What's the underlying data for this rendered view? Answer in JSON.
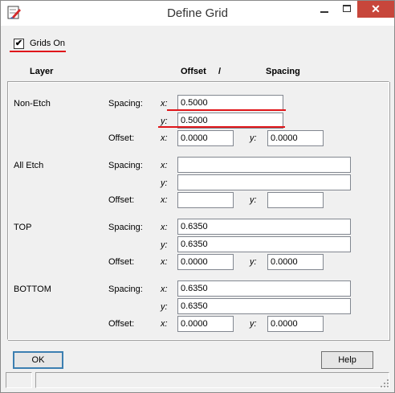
{
  "window": {
    "title": "Define Grid"
  },
  "grids_on": {
    "label": "Grids On",
    "checked": true,
    "check_glyph": "✔"
  },
  "headers": {
    "layer": "Layer",
    "offset": "Offset",
    "slash": "/",
    "spacing": "Spacing"
  },
  "layers": [
    {
      "name": "Non-Etch",
      "spacing_label": "Spacing:",
      "x_label": "x:",
      "spacing_x": "0.5000",
      "y_label": "y:",
      "spacing_y": "0.5000",
      "offset_label": "Offset:",
      "offset_x": "0.0000",
      "offset_y": "0.0000"
    },
    {
      "name": "All Etch",
      "spacing_label": "Spacing:",
      "x_label": "x:",
      "spacing_x": "",
      "y_label": "y:",
      "spacing_y": "",
      "offset_label": "Offset:",
      "offset_x": "",
      "offset_y": ""
    },
    {
      "name": "TOP",
      "spacing_label": "Spacing:",
      "x_label": "x:",
      "spacing_x": "0.6350",
      "y_label": "y:",
      "spacing_y": "0.6350",
      "offset_label": "Offset:",
      "offset_x": "0.0000",
      "offset_y": "0.0000"
    },
    {
      "name": "BOTTOM",
      "spacing_label": "Spacing:",
      "x_label": "x:",
      "spacing_x": "0.6350",
      "y_label": "y:",
      "spacing_y": "0.6350",
      "offset_label": "Offset:",
      "offset_x": "0.0000",
      "offset_y": "0.0000"
    }
  ],
  "buttons": {
    "ok": "OK",
    "help": "Help"
  },
  "colors": {
    "annotation_red": "#e0161a",
    "close_button": "#c7463b"
  },
  "icons": {
    "app": "define-grid-app-icon",
    "minimize": "minimize-icon",
    "maximize": "maximize-icon",
    "close": "close-icon",
    "resize": "resize-grip-icon"
  }
}
